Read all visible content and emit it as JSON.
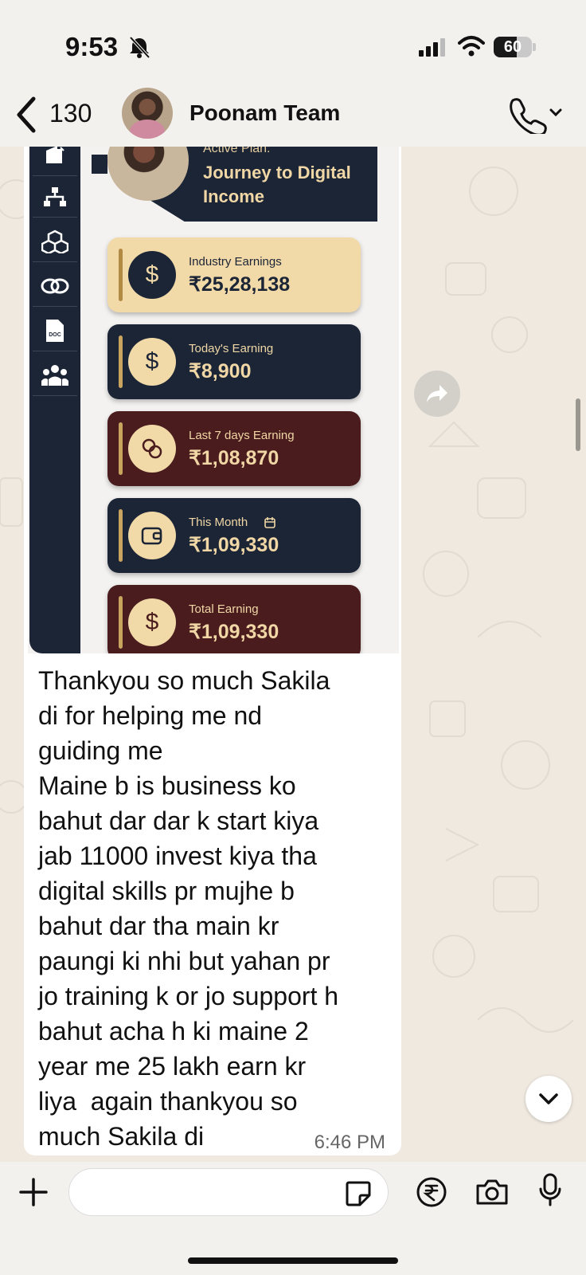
{
  "status_bar": {
    "time": "9:53",
    "battery": "60",
    "battery_level": 0.6
  },
  "header": {
    "back_count": "130",
    "title": "Poonam Team"
  },
  "shared_image": {
    "plan_label": "Active Plan:",
    "plan_name": "Journey to Digital Income",
    "sidebar_icons": [
      "wallet-icon",
      "network-icon",
      "boxes-icon",
      "link-icon",
      "doc-icon",
      "team-icon"
    ],
    "doc_icon_text": "DOC",
    "cards": [
      {
        "label": "Industry Earnings",
        "value": "₹25,28,138",
        "icon": "$",
        "bg": "#f1d9a8",
        "text": "#1b2536",
        "circle": "#1b2536",
        "circle_text": "#f1d9a8",
        "bar": "#b08a45"
      },
      {
        "label": "Today's Earning",
        "value": "₹8,900",
        "icon": "$",
        "bg": "#1b2536",
        "text": "#f0d7a5",
        "circle": "#f1d9a8",
        "circle_text": "#1b2536",
        "bar": "#c9a45e"
      },
      {
        "label": "Last 7 days Earning",
        "value": "₹1,08,870",
        "icon": "coins",
        "bg": "#4a1c1e",
        "text": "#f0d7a5",
        "circle": "#f1d9a8",
        "circle_text": "#4a1c1e",
        "bar": "#c9a45e"
      },
      {
        "label": "This Month",
        "value": "₹1,09,330",
        "icon": "wallet",
        "bg": "#1b2536",
        "text": "#f0d7a5",
        "circle": "#f1d9a8",
        "circle_text": "#1b2536",
        "bar": "#c9a45e"
      },
      {
        "label": "Total Earning",
        "value": "₹1,09,330",
        "icon": "$",
        "bg": "#4a1c1e",
        "text": "#f0d7a5",
        "circle": "#f1d9a8",
        "circle_text": "#4a1c1e",
        "bar": "#c9a45e"
      }
    ]
  },
  "message": {
    "lines": [
      "Thankyou so much Sakila",
      "di for helping me nd",
      "guiding me",
      "Maine b is business ko",
      "bahut dar dar k start kiya",
      "jab 11000 invest kiya tha",
      "digital skills pr mujhe b",
      "bahut dar tha main kr",
      "paungi ki nhi but yahan pr",
      "jo training k or jo support h",
      "bahut acha h ki maine 2",
      "year me 25 lakh earn kr",
      "liya  again thankyou so",
      "much Sakila di"
    ],
    "time": "6:46 PM"
  },
  "composer": {
    "placeholder": ""
  }
}
